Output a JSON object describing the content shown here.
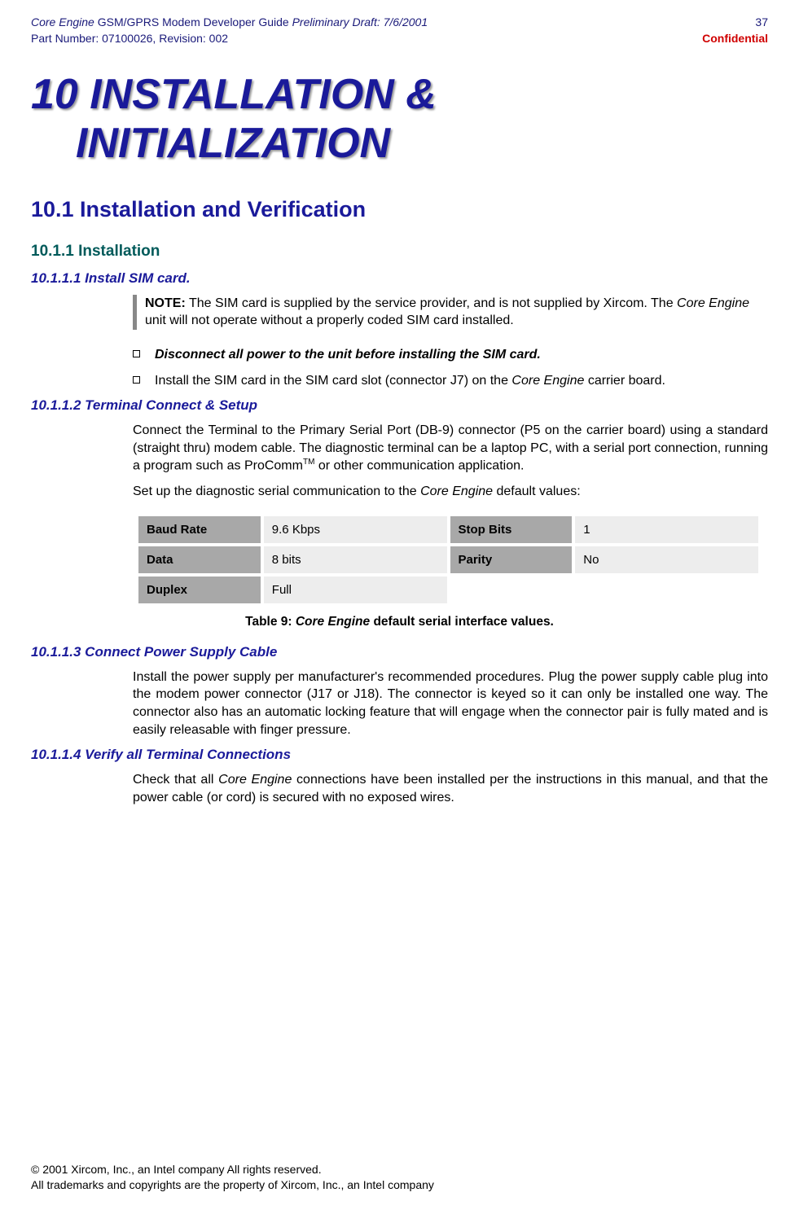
{
  "header": {
    "title_part1": "Core Engine",
    "title_part2": " GSM/GPRS Modem Developer Guide ",
    "title_part3": "Preliminary Draft: 7/6/2001",
    "part_number": "Part Number: 07100026, Revision: 002",
    "page_number": "37",
    "confidential": "Confidential"
  },
  "main_heading": {
    "line1": "10 INSTALLATION &",
    "line2": "INITIALIZATION"
  },
  "h2_1": "10.1 Installation and Verification",
  "h3_1": "10.1.1 Installation",
  "section1": {
    "heading": "10.1.1.1 Install SIM card.",
    "note_label": "NOTE:",
    "note_text_1": "  The SIM card is supplied by the service provider, and is not supplied by Xircom.  The ",
    "note_italic": "Core Engine",
    "note_text_2": " unit will not operate without a properly coded SIM card installed.",
    "bullet1": "Disconnect all power to the unit before installing the SIM card.",
    "bullet2_a": "Install the SIM card in the SIM card slot (connector J7) on the ",
    "bullet2_italic": "Core Engine",
    "bullet2_b": " carrier board."
  },
  "section2": {
    "heading": "10.1.1.2 Terminal Connect & Setup",
    "para1_a": "Connect the Terminal to the Primary Serial Port (DB-9) connector (P5 on the carrier board) using a standard (straight thru) modem cable.  The diagnostic terminal can be a laptop PC, with a serial port connection, running a program such as ProComm",
    "para1_tm": "TM",
    "para1_b": " or other communication application.",
    "para2_a": "Set up the diagnostic serial communication to the ",
    "para2_italic": "Core Engine",
    "para2_b": " default values:"
  },
  "table": {
    "rows": [
      {
        "label1": "Baud Rate",
        "value1": "9.6 Kbps",
        "label2": "Stop Bits",
        "value2": "1"
      },
      {
        "label1": "Data",
        "value1": "8 bits",
        "label2": "Parity",
        "value2": "No"
      },
      {
        "label1": "Duplex",
        "value1": "Full",
        "label2": "",
        "value2": ""
      }
    ],
    "caption_a": "Table 9:  ",
    "caption_italic": "Core Engine",
    "caption_b": " default serial interface values."
  },
  "section3": {
    "heading": "10.1.1.3 Connect Power Supply Cable",
    "para": "Install the power supply per manufacturer's recommended procedures.  Plug the power supply cable plug into the modem power connector (J17 or J18).  The connector is keyed so it can only be installed one way.  The connector also has an automatic locking feature that will engage when the connector pair is fully mated and is easily releasable with finger pressure."
  },
  "section4": {
    "heading": "10.1.1.4 Verify all Terminal Connections",
    "para_a": "Check that all ",
    "para_italic": "Core Engine",
    "para_b": " connections have been installed per the instructions in this manual, and that the power cable (or cord) is secured with no exposed wires."
  },
  "footer": {
    "line1": "© 2001 Xircom, Inc., an Intel company All rights reserved.",
    "line2": "All trademarks and copyrights are the property of Xircom, Inc., an Intel company"
  }
}
